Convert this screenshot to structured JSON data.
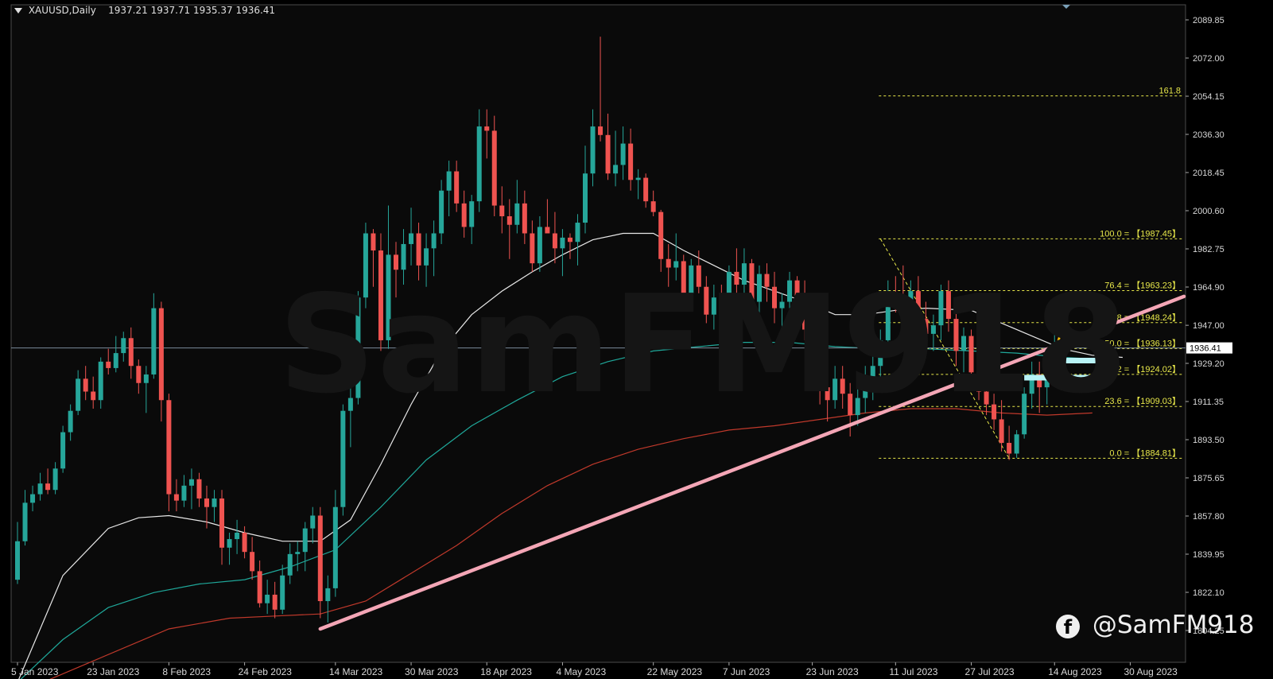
{
  "header": {
    "symbol": "XAUUSD,Daily",
    "ohlc": "1937.21 1937.71 1935.37 1936.41"
  },
  "watermark": "SamFM918",
  "brand": {
    "handle": "@SamFM918",
    "icon": "facebook-icon"
  },
  "colors": {
    "background": "#0a0a0a",
    "bull": "#26a69a",
    "bear": "#ef5350",
    "ma_white": "#e8e8e8",
    "ma_teal": "#1fa89a",
    "ma_red": "#c0392b",
    "trendline": "#f4a6b6",
    "fib": "#e8e84a",
    "zone": "#b8f3f6",
    "arrow": "#f2b705"
  },
  "chart_data": {
    "type": "candlestick",
    "symbol": "XAUUSD",
    "timeframe": "Daily",
    "last_price": "1936.41",
    "y_ticks": [
      "2089.85",
      "2072.00",
      "2054.15",
      "2036.30",
      "2018.45",
      "2000.60",
      "1982.75",
      "1964.90",
      "1947.00",
      "1929.20",
      "1911.35",
      "1893.50",
      "1875.65",
      "1857.80",
      "1839.95",
      "1822.10",
      "1804.25"
    ],
    "x_labels": [
      "5 Jan 2023",
      "23 Jan 2023",
      "8 Feb 2023",
      "24 Feb 2023",
      "14 Mar 2023",
      "30 Mar 2023",
      "18 Apr 2023",
      "4 May 2023",
      "22 May 2023",
      "7 Jun 2023",
      "23 Jun 2023",
      "11 Jul 2023",
      "27 Jul 2023",
      "14 Aug 2023",
      "30 Aug 2023"
    ],
    "fib_levels": [
      {
        "label": "161.8",
        "value": 2054.3
      },
      {
        "label": "100.0 = 【1987.45】",
        "value": 1987.45
      },
      {
        "label": "76.4 = 【1963.23】",
        "value": 1963.23
      },
      {
        "label": "61.8 = 【1948.24】",
        "value": 1948.24
      },
      {
        "label": "50.0 = 【1936.13】",
        "value": 1936.13
      },
      {
        "label": "38.2 = 【1924.02】",
        "value": 1924.02
      },
      {
        "label": "23.6 = 【1909.03】",
        "value": 1909.03
      },
      {
        "label": "0.0 = 【1884.81】",
        "value": 1884.81
      }
    ],
    "fib_anchor_bar": 114,
    "trendline": {
      "from_bar": 40,
      "from_price": 1805.0,
      "to_bar": 155,
      "to_price": 1960.5
    },
    "zones": [
      {
        "bar_from": 138,
        "bar_to": 143,
        "price": 1930.5
      },
      {
        "bar_from": 133,
        "bar_to": 143,
        "price": 1922.5
      }
    ],
    "candles": [
      [
        1828,
        1855,
        1826,
        1846
      ],
      [
        1846,
        1870,
        1844,
        1864
      ],
      [
        1864,
        1872,
        1860,
        1868
      ],
      [
        1868,
        1878,
        1865,
        1873
      ],
      [
        1873,
        1880,
        1868,
        1870
      ],
      [
        1870,
        1883,
        1868,
        1880
      ],
      [
        1880,
        1900,
        1878,
        1897
      ],
      [
        1897,
        1910,
        1893,
        1907
      ],
      [
        1907,
        1926,
        1905,
        1922
      ],
      [
        1922,
        1928,
        1912,
        1916
      ],
      [
        1916,
        1923,
        1908,
        1912
      ],
      [
        1912,
        1932,
        1908,
        1930
      ],
      [
        1930,
        1936,
        1924,
        1927
      ],
      [
        1927,
        1942,
        1925,
        1934
      ],
      [
        1934,
        1944,
        1930,
        1941
      ],
      [
        1941,
        1946,
        1922,
        1928
      ],
      [
        1928,
        1931,
        1915,
        1920
      ],
      [
        1920,
        1928,
        1906,
        1924
      ],
      [
        1924,
        1962,
        1922,
        1955
      ],
      [
        1955,
        1958,
        1902,
        1912
      ],
      [
        1912,
        1915,
        1860,
        1868
      ],
      [
        1868,
        1875,
        1860,
        1865
      ],
      [
        1865,
        1877,
        1862,
        1872
      ],
      [
        1872,
        1880,
        1861,
        1875
      ],
      [
        1875,
        1878,
        1862,
        1866
      ],
      [
        1866,
        1872,
        1852,
        1862
      ],
      [
        1862,
        1870,
        1855,
        1866
      ],
      [
        1866,
        1870,
        1835,
        1843
      ],
      [
        1843,
        1850,
        1835,
        1847
      ],
      [
        1847,
        1856,
        1840,
        1850
      ],
      [
        1850,
        1853,
        1838,
        1841
      ],
      [
        1841,
        1848,
        1828,
        1832
      ],
      [
        1832,
        1837,
        1815,
        1817
      ],
      [
        1817,
        1828,
        1812,
        1821
      ],
      [
        1821,
        1827,
        1810,
        1814
      ],
      [
        1814,
        1835,
        1812,
        1830
      ],
      [
        1830,
        1845,
        1826,
        1840
      ],
      [
        1840,
        1846,
        1832,
        1841
      ],
      [
        1841,
        1855,
        1832,
        1852
      ],
      [
        1852,
        1862,
        1845,
        1858
      ],
      [
        1858,
        1862,
        1810,
        1818
      ],
      [
        1818,
        1830,
        1808,
        1824
      ],
      [
        1824,
        1870,
        1820,
        1862
      ],
      [
        1862,
        1910,
        1858,
        1907
      ],
      [
        1907,
        1925,
        1890,
        1913
      ],
      [
        1913,
        1963,
        1910,
        1960
      ],
      [
        1960,
        1995,
        1955,
        1990
      ],
      [
        1990,
        1992,
        1965,
        1982
      ],
      [
        1982,
        1990,
        1935,
        1940
      ],
      [
        1940,
        2003,
        1936,
        1980
      ],
      [
        1980,
        1986,
        1960,
        1973
      ],
      [
        1973,
        1992,
        1966,
        1985
      ],
      [
        1985,
        2002,
        1975,
        1990
      ],
      [
        1990,
        1995,
        1968,
        1975
      ],
      [
        1975,
        1990,
        1965,
        1983
      ],
      [
        1983,
        1996,
        1970,
        1990
      ],
      [
        1990,
        2015,
        1985,
        2010
      ],
      [
        2010,
        2024,
        1998,
        2019
      ],
      [
        2019,
        2024,
        2000,
        2004
      ],
      [
        2004,
        2010,
        1988,
        1993
      ],
      [
        1993,
        2008,
        1985,
        2005
      ],
      [
        2005,
        2048,
        2000,
        2040
      ],
      [
        2040,
        2048,
        2025,
        2038
      ],
      [
        2038,
        2045,
        1998,
        2003
      ],
      [
        2003,
        2012,
        1990,
        1998
      ],
      [
        1998,
        2006,
        1978,
        1994
      ],
      [
        1994,
        2015,
        1990,
        2004
      ],
      [
        2004,
        2010,
        1985,
        1990
      ],
      [
        1990,
        1996,
        1972,
        1976
      ],
      [
        1976,
        1998,
        1972,
        1993
      ],
      [
        1993,
        2006,
        1990,
        1990
      ],
      [
        1990,
        2000,
        1976,
        1983
      ],
      [
        1983,
        1992,
        1970,
        1988
      ],
      [
        1988,
        1990,
        1978,
        1986
      ],
      [
        1986,
        1999,
        1975,
        1995
      ],
      [
        1995,
        2031,
        1990,
        2018
      ],
      [
        2018,
        2048,
        2012,
        2040
      ],
      [
        2040,
        2082,
        2033,
        2036
      ],
      [
        2036,
        2046,
        2015,
        2018
      ],
      [
        2018,
        2038,
        2012,
        2022
      ],
      [
        2022,
        2040,
        2015,
        2032
      ],
      [
        2032,
        2039,
        2010,
        2015
      ],
      [
        2015,
        2020,
        2006,
        2016
      ],
      [
        2016,
        2018,
        2002,
        2005
      ],
      [
        2005,
        2010,
        1998,
        2000
      ],
      [
        2000,
        2001,
        1972,
        1978
      ],
      [
        1978,
        1985,
        1965,
        1974
      ],
      [
        1974,
        1990,
        1968,
        1977
      ],
      [
        1977,
        1980,
        1955,
        1962
      ],
      [
        1962,
        1978,
        1955,
        1975
      ],
      [
        1975,
        1982,
        1962,
        1965
      ],
      [
        1965,
        1970,
        1948,
        1952
      ],
      [
        1952,
        1966,
        1945,
        1960
      ],
      [
        1960,
        1966,
        1947,
        1954
      ],
      [
        1954,
        1975,
        1950,
        1972
      ],
      [
        1972,
        1983,
        1960,
        1966
      ],
      [
        1966,
        1983,
        1958,
        1976
      ],
      [
        1976,
        1978,
        1948,
        1958
      ],
      [
        1958,
        1975,
        1952,
        1971
      ],
      [
        1971,
        1976,
        1958,
        1965
      ],
      [
        1965,
        1972,
        1948,
        1955
      ],
      [
        1955,
        1962,
        1945,
        1958
      ],
      [
        1958,
        1972,
        1955,
        1968
      ],
      [
        1968,
        1970,
        1950,
        1960
      ],
      [
        1960,
        1968,
        1940,
        1945
      ],
      [
        1945,
        1948,
        1925,
        1932
      ],
      [
        1932,
        1940,
        1910,
        1918
      ],
      [
        1918,
        1925,
        1902,
        1912
      ],
      [
        1912,
        1928,
        1908,
        1922
      ],
      [
        1922,
        1928,
        1908,
        1915
      ],
      [
        1915,
        1920,
        1895,
        1905
      ],
      [
        1905,
        1918,
        1900,
        1913
      ],
      [
        1913,
        1928,
        1906,
        1922
      ],
      [
        1922,
        1934,
        1912,
        1928
      ],
      [
        1928,
        1945,
        1922,
        1940
      ],
      [
        1940,
        1968,
        1936,
        1962
      ],
      [
        1962,
        1970,
        1953,
        1960
      ],
      [
        1960,
        1975,
        1945,
        1955
      ],
      [
        1955,
        1968,
        1948,
        1963
      ],
      [
        1963,
        1970,
        1945,
        1950
      ],
      [
        1950,
        1958,
        1935,
        1943
      ],
      [
        1943,
        1952,
        1935,
        1947
      ],
      [
        1947,
        1966,
        1940,
        1963
      ],
      [
        1963,
        1968,
        1944,
        1950
      ],
      [
        1950,
        1955,
        1928,
        1935
      ],
      [
        1935,
        1946,
        1925,
        1942
      ],
      [
        1942,
        1945,
        1918,
        1925
      ],
      [
        1925,
        1930,
        1912,
        1916
      ],
      [
        1916,
        1925,
        1905,
        1910
      ],
      [
        1910,
        1915,
        1898,
        1903
      ],
      [
        1903,
        1912,
        1888,
        1892
      ],
      [
        1892,
        1900,
        1884,
        1887
      ],
      [
        1887,
        1898,
        1885,
        1896
      ],
      [
        1896,
        1918,
        1894,
        1915
      ],
      [
        1915,
        1930,
        1908,
        1924
      ],
      [
        1924,
        1930,
        1906,
        1918
      ],
      [
        1918,
        1935,
        1910,
        1925
      ],
      [
        1925,
        1945,
        1920,
        1936
      ]
    ],
    "ma_white": [
      [
        0,
        1780
      ],
      [
        6,
        1830
      ],
      [
        12,
        1852
      ],
      [
        16,
        1857
      ],
      [
        20,
        1858
      ],
      [
        25,
        1855
      ],
      [
        30,
        1850
      ],
      [
        35,
        1846
      ],
      [
        40,
        1846
      ],
      [
        44,
        1856
      ],
      [
        48,
        1882
      ],
      [
        52,
        1910
      ],
      [
        56,
        1935
      ],
      [
        60,
        1952
      ],
      [
        64,
        1963
      ],
      [
        68,
        1972
      ],
      [
        72,
        1980
      ],
      [
        76,
        1987
      ],
      [
        80,
        1990
      ],
      [
        84,
        1990
      ],
      [
        88,
        1982
      ],
      [
        92,
        1975
      ],
      [
        96,
        1968
      ],
      [
        100,
        1963
      ],
      [
        104,
        1958
      ],
      [
        108,
        1952
      ],
      [
        112,
        1952
      ],
      [
        116,
        1954
      ],
      [
        120,
        1955
      ],
      [
        126,
        1954
      ],
      [
        130,
        1948
      ],
      [
        134,
        1942
      ],
      [
        138,
        1936
      ],
      [
        142,
        1933
      ],
      [
        146,
        1932
      ]
    ],
    "ma_teal": [
      [
        0,
        1780
      ],
      [
        6,
        1800
      ],
      [
        12,
        1815
      ],
      [
        18,
        1822
      ],
      [
        24,
        1826
      ],
      [
        30,
        1828
      ],
      [
        36,
        1834
      ],
      [
        42,
        1842
      ],
      [
        48,
        1862
      ],
      [
        54,
        1884
      ],
      [
        60,
        1900
      ],
      [
        66,
        1912
      ],
      [
        72,
        1923
      ],
      [
        78,
        1930
      ],
      [
        84,
        1935
      ],
      [
        90,
        1937
      ],
      [
        96,
        1939
      ],
      [
        102,
        1939
      ],
      [
        108,
        1937
      ],
      [
        114,
        1936
      ],
      [
        120,
        1936
      ],
      [
        126,
        1935
      ],
      [
        132,
        1934
      ],
      [
        138,
        1932
      ],
      [
        144,
        1931
      ]
    ],
    "ma_red": [
      [
        0,
        1775
      ],
      [
        10,
        1790
      ],
      [
        20,
        1805
      ],
      [
        28,
        1810
      ],
      [
        34,
        1811
      ],
      [
        40,
        1812
      ],
      [
        46,
        1818
      ],
      [
        52,
        1831
      ],
      [
        58,
        1844
      ],
      [
        64,
        1859
      ],
      [
        70,
        1872
      ],
      [
        76,
        1882
      ],
      [
        82,
        1889
      ],
      [
        88,
        1894
      ],
      [
        94,
        1898
      ],
      [
        100,
        1900
      ],
      [
        106,
        1903
      ],
      [
        112,
        1906
      ],
      [
        118,
        1908
      ],
      [
        124,
        1908
      ],
      [
        130,
        1906
      ],
      [
        136,
        1905
      ],
      [
        142,
        1906
      ]
    ]
  }
}
